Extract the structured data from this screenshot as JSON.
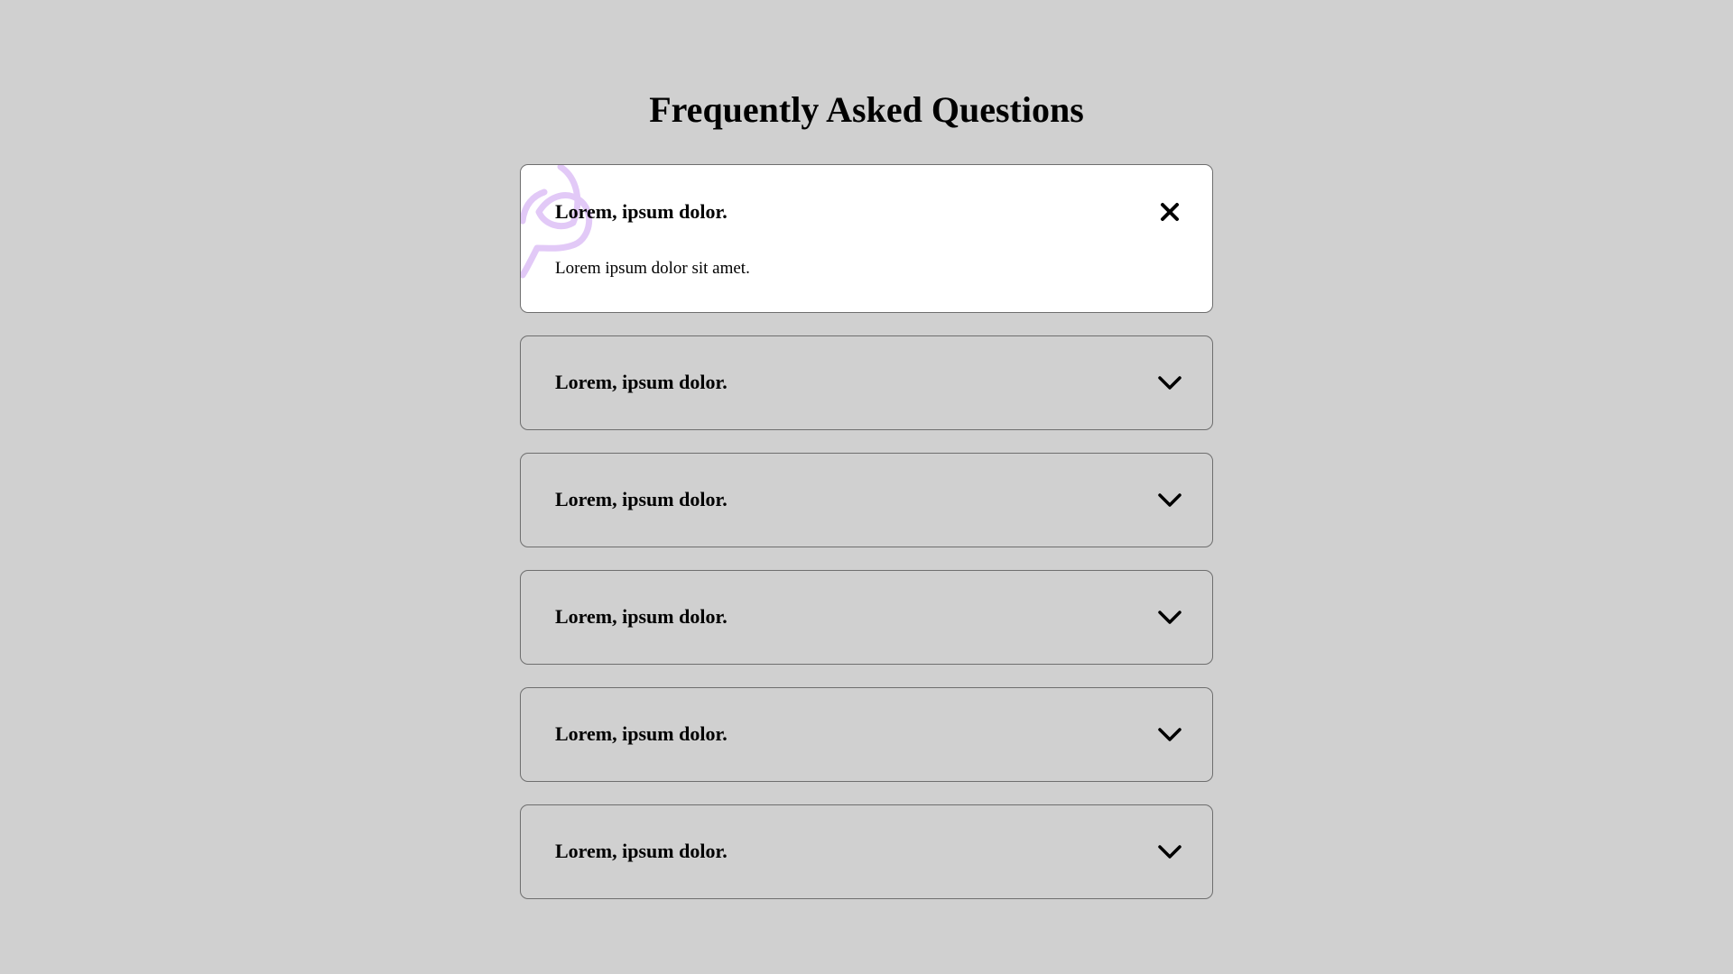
{
  "page": {
    "title": "Frequently Asked Questions"
  },
  "faq": [
    {
      "question": "Lorem, ipsum dolor.",
      "answer": "Lorem ipsum dolor sit amet.",
      "state": "open",
      "toggle_icon": "close-icon"
    },
    {
      "question": "Lorem, ipsum dolor.",
      "state": "closed",
      "toggle_icon": "chevron-down-icon"
    },
    {
      "question": "Lorem, ipsum dolor.",
      "state": "closed",
      "toggle_icon": "chevron-down-icon"
    },
    {
      "question": "Lorem, ipsum dolor.",
      "state": "closed",
      "toggle_icon": "chevron-down-icon"
    },
    {
      "question": "Lorem, ipsum dolor.",
      "state": "closed",
      "toggle_icon": "chevron-down-icon"
    },
    {
      "question": "Lorem, ipsum dolor.",
      "state": "closed",
      "toggle_icon": "chevron-down-icon"
    }
  ],
  "decoration": {
    "icon": "speech-bubbles-icon",
    "color": "#e2c9f7"
  },
  "colors": {
    "background": "#d0d0d0",
    "open_card": "#ffffff",
    "border": "#6e6e6e"
  }
}
